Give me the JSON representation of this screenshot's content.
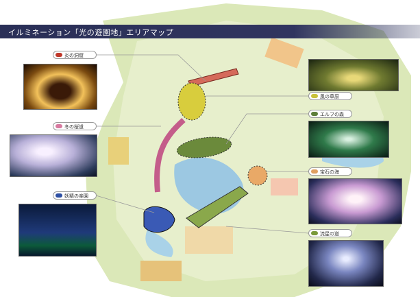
{
  "title": "イルミネーション「光の遊園地」エリアマップ",
  "areas": [
    {
      "label": "炎の洞窟",
      "color": "#c0392b"
    },
    {
      "label": "冬の桜道",
      "color": "#d77aa0"
    },
    {
      "label": "妖精の楽園",
      "color": "#2d4fa3"
    },
    {
      "label": "風の草原",
      "color": "#c9c23b"
    },
    {
      "label": "エルフの森",
      "color": "#5e7f3a"
    },
    {
      "label": "宝石の海",
      "color": "#e0a060"
    },
    {
      "label": "流星の道",
      "color": "#7a9a3a"
    }
  ]
}
